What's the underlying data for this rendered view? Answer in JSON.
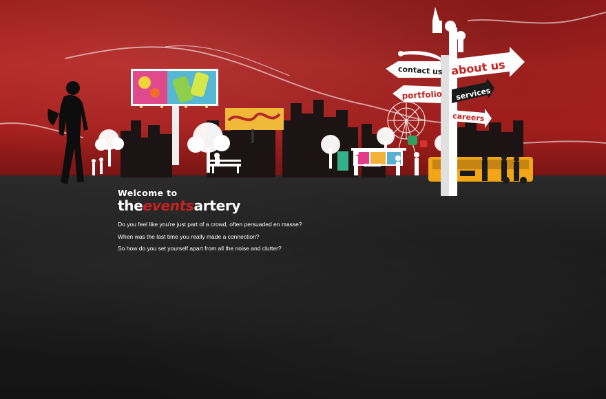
{
  "welcome": {
    "intro": "Welcome to",
    "brand_prefix": "the",
    "brand_highlight": "events",
    "brand_suffix": "artery",
    "questions": [
      "Do you feel like you're just part of a crowd, often persuaded en masse?",
      "When was the last time you really made a connection?",
      "So how do you set yourself apart from all the noise and clutter?"
    ]
  },
  "nav": {
    "contact": "contact us",
    "about": "about us",
    "portfolio": "portfolio",
    "services": "services",
    "careers": "careers"
  },
  "colors": {
    "wall": "#a51f1d",
    "brand_accent": "#c8211f",
    "ground": "#1c1c1c"
  }
}
